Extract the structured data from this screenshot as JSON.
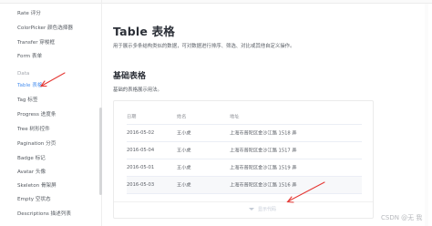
{
  "sidebar": {
    "items": [
      {
        "label": "Rate 评分",
        "type": "item"
      },
      {
        "label": "ColorPicker 颜色选择器",
        "type": "item"
      },
      {
        "label": "Transfer 穿梭框",
        "type": "item"
      },
      {
        "label": "Form 表单",
        "type": "item"
      },
      {
        "label": "Data",
        "type": "group"
      },
      {
        "label": "Table 表格",
        "type": "active"
      },
      {
        "label": "Tag 标签",
        "type": "item"
      },
      {
        "label": "Progress 进度条",
        "type": "item"
      },
      {
        "label": "Tree 树形控件",
        "type": "item"
      },
      {
        "label": "Pagination 分页",
        "type": "item"
      },
      {
        "label": "Badge 标记",
        "type": "item"
      },
      {
        "label": "Avatar 头像",
        "type": "item"
      },
      {
        "label": "Skeleton 骨架屏",
        "type": "item"
      },
      {
        "label": "Empty 空状态",
        "type": "item"
      },
      {
        "label": "Descriptions 描述列表",
        "type": "item"
      }
    ]
  },
  "main": {
    "title": "Table 表格",
    "description": "用于展示多条结构类似的数据，可对数据进行排序、筛选、对比或其他自定义操作。",
    "section_title": "基础表格",
    "section_description": "基础的表格展示用法。",
    "table": {
      "headers": [
        "日期",
        "姓名",
        "地址"
      ],
      "rows": [
        {
          "date": "2016-05-02",
          "name": "王小虎",
          "address": "上海市普陀区金沙江路 1518 弄"
        },
        {
          "date": "2016-05-04",
          "name": "王小虎",
          "address": "上海市普陀区金沙江路 1517 弄"
        },
        {
          "date": "2016-05-01",
          "name": "王小虎",
          "address": "上海市普陀区金沙江路 1519 弄"
        },
        {
          "date": "2016-05-03",
          "name": "王小虎",
          "address": "上海市普陀区金沙江路 1516 弄"
        }
      ]
    },
    "footer_text": "显示代码"
  },
  "colors": {
    "accent": "#4e93f0",
    "annotation": "#e53935"
  },
  "watermark": "CSDN @无 我"
}
